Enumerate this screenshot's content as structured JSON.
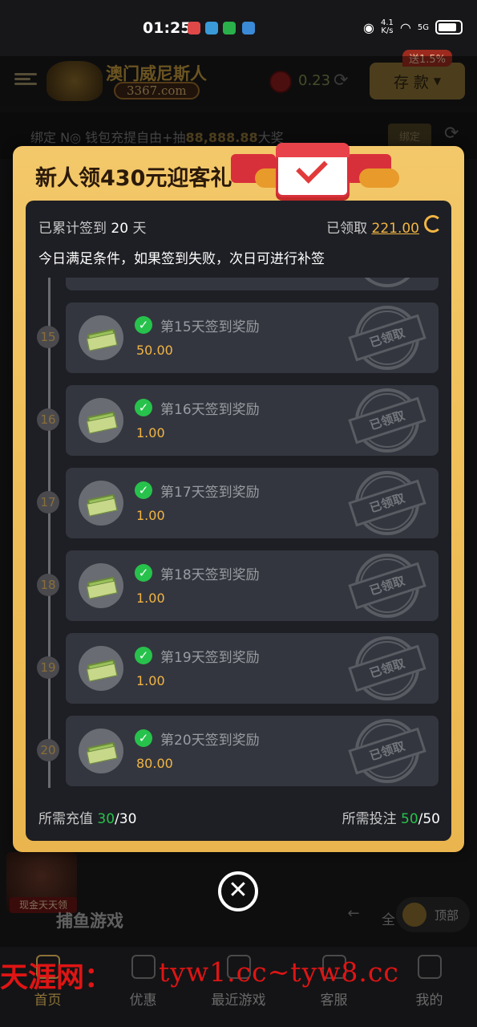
{
  "status_bar": {
    "time": "01:25",
    "net_speed_top": "4.1",
    "net_speed_unit": "K/s",
    "signal": "5G"
  },
  "header": {
    "logo_text": "澳门威尼斯人",
    "logo_domain": "3367.com",
    "balance": "0.23",
    "deposit_label": "存 款",
    "deposit_badge": "送1.5%"
  },
  "bind_bar": {
    "text_pre": "绑定 N",
    "text_mid": " 钱包充提自由+抽",
    "text_amount": "88,888.88",
    "text_post": "大奖",
    "button": "绑定"
  },
  "modal": {
    "title": "新人领430元迎客礼",
    "signed_label": "已累计签到",
    "signed_days": "20",
    "signed_unit": "天",
    "claimed_label": "已领取",
    "claimed_value": "221.00",
    "note": "今日满足条件，如果签到失败，次日可进行补签",
    "stamp_text": "已领取",
    "rewards": [
      {
        "day": "15",
        "title": "第15天签到奖励",
        "amount": "50.00"
      },
      {
        "day": "16",
        "title": "第16天签到奖励",
        "amount": "1.00"
      },
      {
        "day": "17",
        "title": "第17天签到奖励",
        "amount": "1.00"
      },
      {
        "day": "18",
        "title": "第18天签到奖励",
        "amount": "1.00"
      },
      {
        "day": "19",
        "title": "第19天签到奖励",
        "amount": "1.00"
      },
      {
        "day": "20",
        "title": "第20天签到奖励",
        "amount": "80.00"
      }
    ],
    "footer": {
      "recharge_label": "所需充值",
      "recharge_done": "30",
      "recharge_total": "/30",
      "bet_label": "所需投注",
      "bet_done": "50",
      "bet_total": "/50"
    }
  },
  "background": {
    "avatar_tag": "现金天天领",
    "section_label": "捕鱼游戏",
    "all_label": "全",
    "top_label": "顶部"
  },
  "bottom_nav": [
    {
      "label": "首页"
    },
    {
      "label": "优惠"
    },
    {
      "label": "最近游戏"
    },
    {
      "label": "客服"
    },
    {
      "label": "我的"
    }
  ],
  "watermark": {
    "cn": "天涯网：",
    "url": "tyw1.cc~tyw8.cc"
  },
  "colors": {
    "gold": "#f2b544",
    "green": "#27c24c",
    "modal_bg": "#f0c05a",
    "panel_bg": "#1e1f24",
    "card_bg": "#34363f",
    "watermark_red": "#e01414"
  }
}
